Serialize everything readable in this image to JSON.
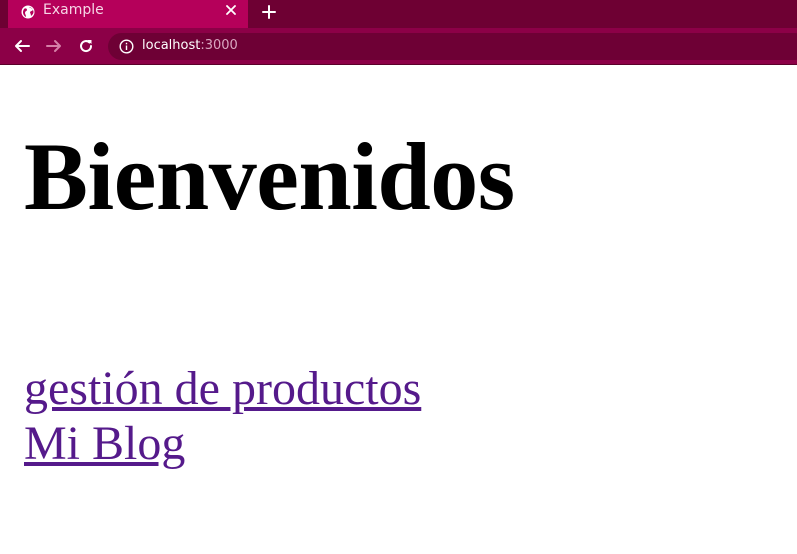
{
  "browser": {
    "tab": {
      "title": "Example",
      "favicon": "globe-icon",
      "close_icon": "close-icon"
    },
    "new_tab_icon": "plus-icon",
    "toolbar": {
      "back_icon": "arrow-left-icon",
      "forward_icon": "arrow-right-icon",
      "reload_icon": "reload-icon",
      "info_icon": "info-icon"
    },
    "address": {
      "host": "localhost",
      "port": ":3000"
    },
    "colors": {
      "tabstrip": "#6e0033",
      "active_tab": "#b5005a",
      "toolbar": "#8c0047",
      "omnibox": "#6e0035"
    }
  },
  "page": {
    "heading": "Bienvenidos",
    "links": [
      {
        "label": "gestión de productos"
      },
      {
        "label": "Mi Blog"
      }
    ],
    "link_color": "#551a8b"
  }
}
